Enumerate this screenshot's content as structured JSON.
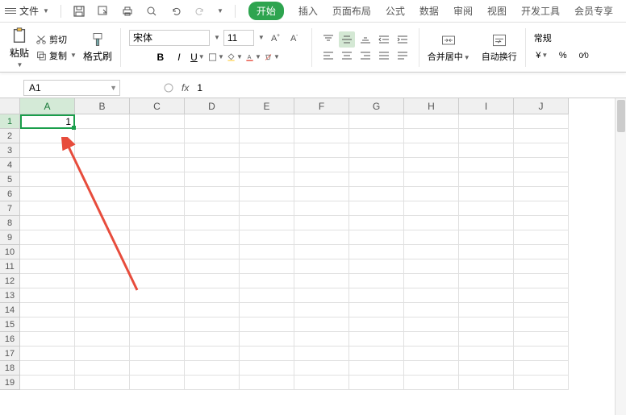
{
  "menu": {
    "file": "文件",
    "tabs": [
      "开始",
      "插入",
      "页面布局",
      "公式",
      "数据",
      "审阅",
      "视图",
      "开发工具",
      "会员专享"
    ],
    "active_tab": 0
  },
  "ribbon": {
    "paste": "粘贴",
    "cut": "剪切",
    "copy": "复制",
    "format_painter": "格式刷",
    "font_name": "宋体",
    "font_size": "11",
    "merge": "合并居中",
    "wrap": "自动换行",
    "number_format": "常规"
  },
  "formula_bar": {
    "cell_ref": "A1",
    "fx": "fx",
    "value": "1"
  },
  "sheet": {
    "columns": [
      "A",
      "B",
      "C",
      "D",
      "E",
      "F",
      "G",
      "H",
      "I",
      "J"
    ],
    "rows": [
      "1",
      "2",
      "3",
      "4",
      "5",
      "6",
      "7",
      "8",
      "9",
      "10",
      "11",
      "12",
      "13",
      "14",
      "15",
      "16",
      "17",
      "18",
      "19"
    ],
    "active_col": 0,
    "active_row": 0,
    "cell_A1": "1"
  }
}
